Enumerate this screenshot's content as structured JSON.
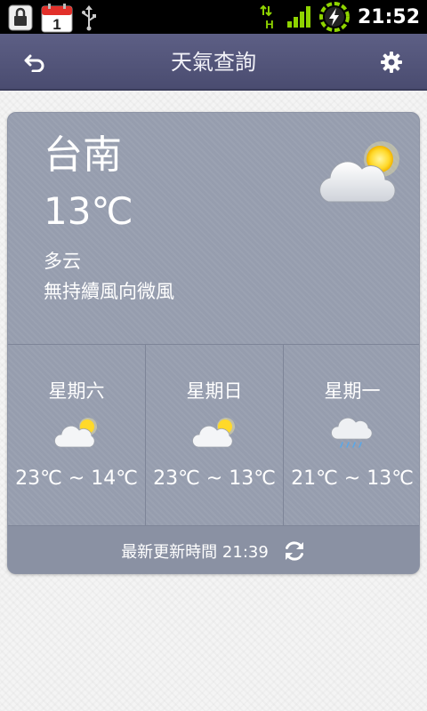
{
  "status_bar": {
    "clock": "21:52",
    "calendar_day": "1",
    "network_type": "H",
    "icons": [
      "lock-icon",
      "calendar-icon",
      "usb-icon",
      "network-h-icon",
      "signal-icon",
      "battery-charging-icon"
    ]
  },
  "title_bar": {
    "title": "天氣查詢",
    "back_icon": "back-arrow-icon",
    "settings_icon": "gear-icon"
  },
  "current": {
    "city": "台南",
    "temperature": "13℃",
    "condition": "多云",
    "wind": "無持續風向微風",
    "icon": "partly-cloudy-icon"
  },
  "forecast": [
    {
      "day": "星期六",
      "range": "23℃ ~ 14℃",
      "icon": "partly-cloudy-icon"
    },
    {
      "day": "星期日",
      "range": "23℃ ~ 13℃",
      "icon": "partly-cloudy-icon"
    },
    {
      "day": "星期一",
      "range": "21℃ ~ 13℃",
      "icon": "rain-cloud-icon"
    }
  ],
  "update": {
    "text": "最新更新時間 21:39",
    "refresh_icon": "refresh-icon"
  },
  "colors": {
    "title_bar": "#4f5176",
    "card": "#969dae",
    "accent_green": "#8fd400"
  }
}
